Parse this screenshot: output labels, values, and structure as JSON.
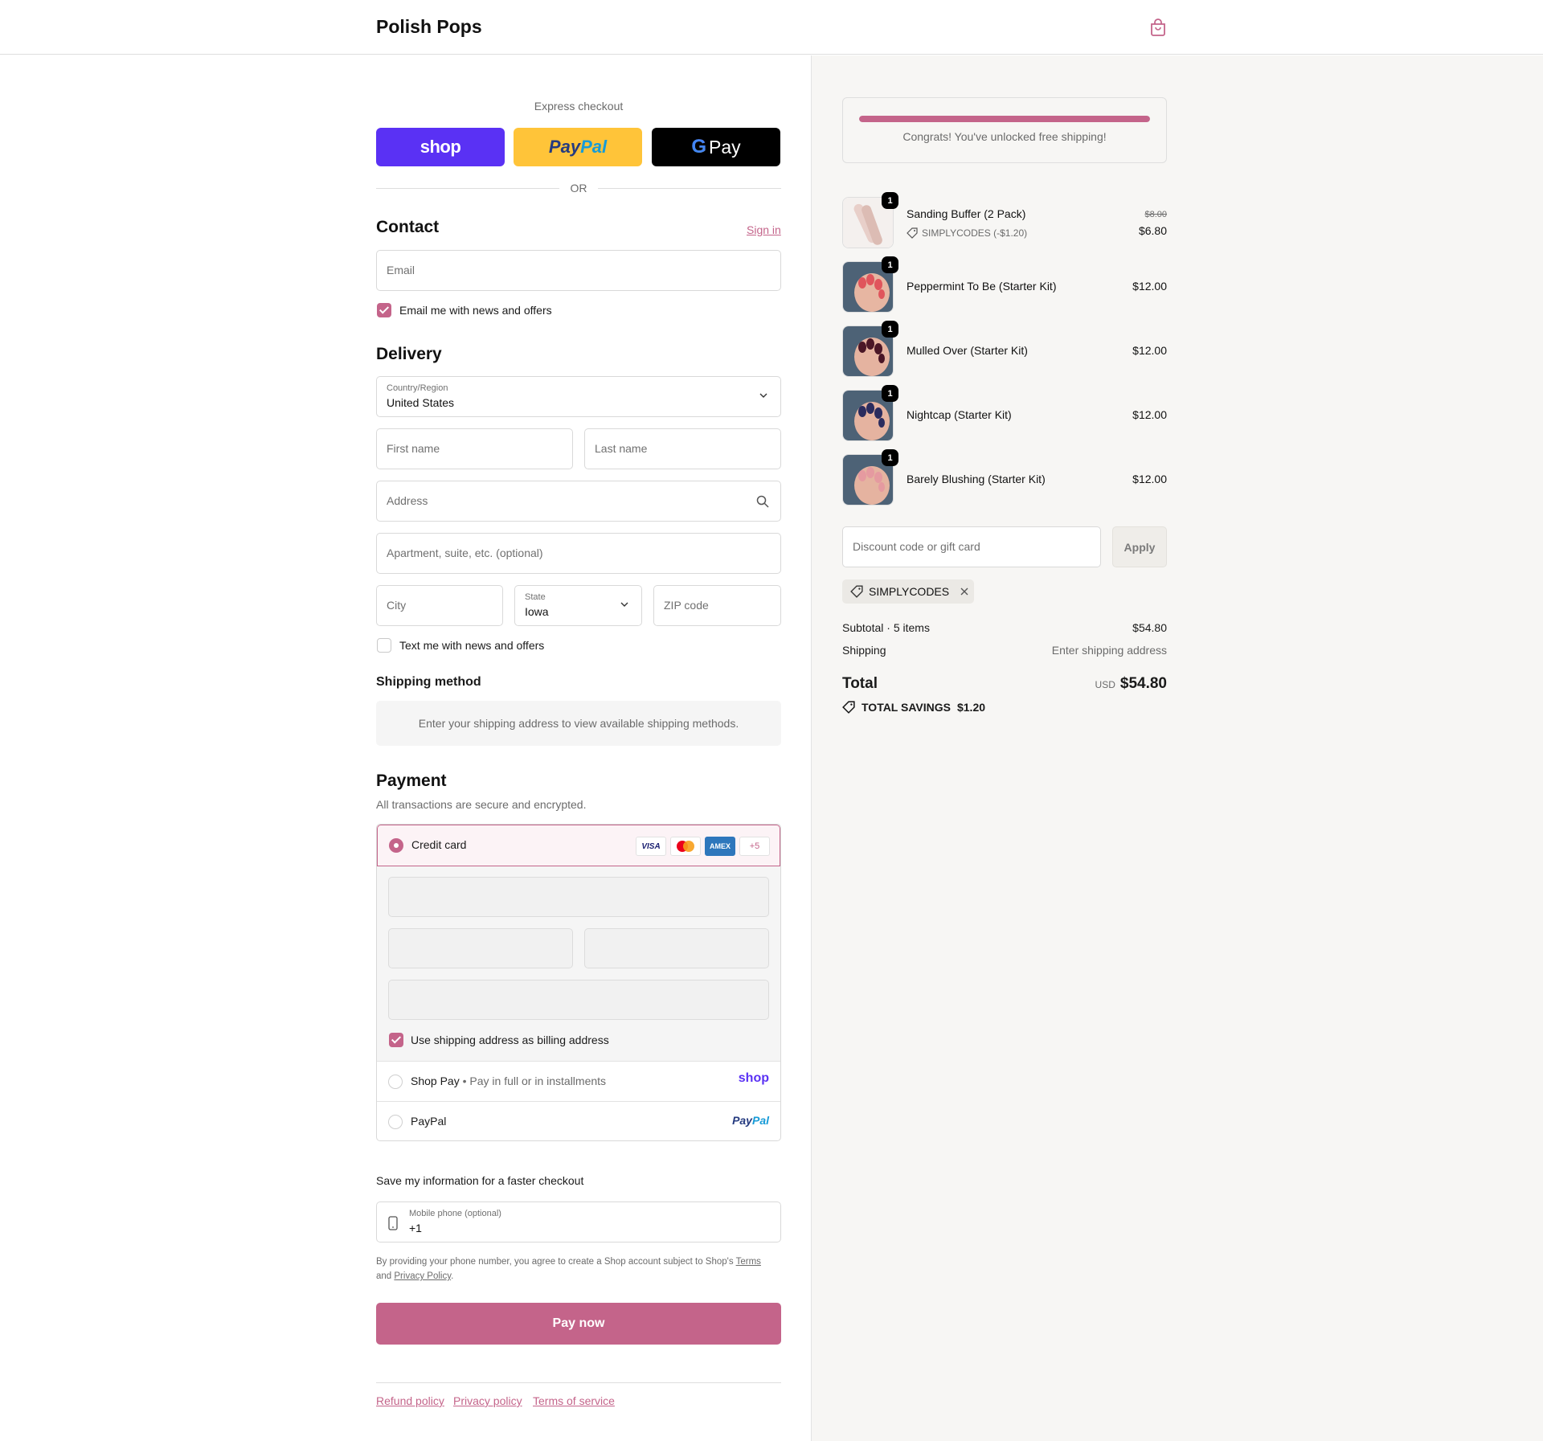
{
  "header": {
    "brand": "Polish Pops"
  },
  "express": {
    "label": "Express checkout",
    "shop": "shop",
    "paypal_a": "Pay",
    "paypal_b": "Pal",
    "gpay_g": "G",
    "gpay_text": "Pay",
    "or": "OR"
  },
  "contact": {
    "title": "Contact",
    "sign_in": "Sign in",
    "email_placeholder": "Email",
    "news_label": "Email me with news and offers",
    "news_checked": true
  },
  "delivery": {
    "title": "Delivery",
    "country_label": "Country/Region",
    "country_value": "United States",
    "first_name": "First name",
    "last_name": "Last name",
    "address": "Address",
    "apartment": "Apartment, suite, etc. (optional)",
    "city": "City",
    "state_label": "State",
    "state_value": "Iowa",
    "zip": "ZIP code",
    "text_label": "Text me with news and offers",
    "text_checked": false
  },
  "shipping_method": {
    "title": "Shipping method",
    "note": "Enter your shipping address to view available shipping methods."
  },
  "payment": {
    "title": "Payment",
    "subtitle": "All transactions are secure and encrypted.",
    "credit_card": "Credit card",
    "cards": [
      "VISA",
      "AMEX",
      "+5"
    ],
    "billing_label": "Use shipping address as billing address",
    "shop_pay": "Shop Pay",
    "shop_pay_sub": "Pay in full or in installments",
    "shop_logo": "shop",
    "paypal": "PayPal",
    "paypal_logo_a": "Pay",
    "paypal_logo_b": "Pal"
  },
  "save_info": {
    "title": "Save my information for a faster checkout",
    "phone_label": "Mobile phone (optional)",
    "phone_value": "+1",
    "legal_a": "By providing your phone number, you agree to create a Shop account subject to Shop's",
    "terms": "Terms",
    "legal_b": "and",
    "privacy": "Privacy Policy",
    "legal_c": "."
  },
  "pay_now": "Pay now",
  "footer": [
    "Refund policy",
    "Privacy policy",
    "Terms of service"
  ],
  "order": {
    "shipping_banner": "Congrats! You've unlocked free shipping!",
    "shipping_progress": 1.0,
    "items": [
      {
        "name": "Sanding Buffer (2 Pack)",
        "qty": "1",
        "price": "$6.80",
        "original_price": "$8.00",
        "discount": "SIMPLYCODES (-$1.20)"
      },
      {
        "name": "Peppermint To Be (Starter Kit)",
        "qty": "1",
        "price": "$12.00"
      },
      {
        "name": "Mulled Over (Starter Kit)",
        "qty": "1",
        "price": "$12.00"
      },
      {
        "name": "Nightcap (Starter Kit)",
        "qty": "1",
        "price": "$12.00"
      },
      {
        "name": "Barely Blushing (Starter Kit)",
        "qty": "1",
        "price": "$12.00"
      }
    ],
    "discount_placeholder": "Discount code or gift card",
    "apply": "Apply",
    "applied_code": "SIMPLYCODES",
    "subtotal_label": "Subtotal · 5 items",
    "subtotal_value": "$54.80",
    "shipping_label": "Shipping",
    "shipping_value": "Enter shipping address",
    "total_label": "Total",
    "currency": "USD",
    "total_value": "$54.80",
    "savings_label": "TOTAL SAVINGS",
    "savings_value": "$1.20"
  },
  "colors": {
    "accent": "#c4648a",
    "shop": "#5a31f4",
    "paypal": "#ffc439",
    "gpay": "#000000"
  }
}
